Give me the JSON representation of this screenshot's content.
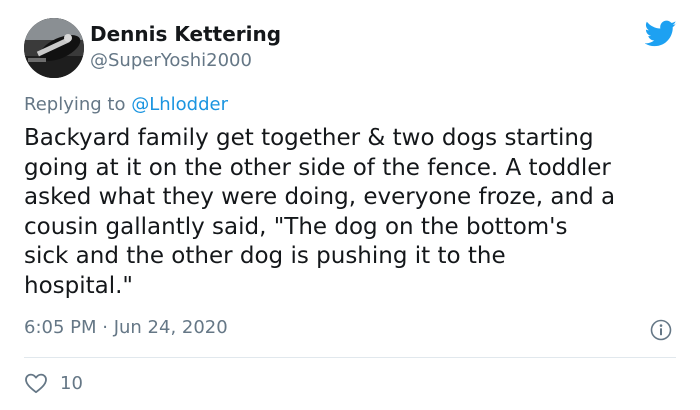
{
  "author": {
    "display_name": "Dennis Kettering",
    "handle": "@SuperYoshi2000",
    "avatar_icon": "user-avatar-photo"
  },
  "reply": {
    "prefix": "Replying to ",
    "mention": "@Lhlodder"
  },
  "tweet": {
    "text": "Backyard family get together & two dogs starting\ngoing at it on the other side of the fence. A toddler\nasked what they were doing, everyone froze, and a\ncousin gallantly said, \"The dog on the bottom's\nsick and the other dog is pushing it to the\nhospital.\"",
    "timestamp": "6:05 PM · Jun 24, 2020"
  },
  "engagement": {
    "like_count": "10"
  },
  "icons": {
    "brand": "twitter-bird-icon",
    "info": "info-icon",
    "like": "heart-icon"
  },
  "colors": {
    "brand_blue": "#1da1f2",
    "mention_blue": "#1b95e0",
    "secondary_text": "#657786",
    "primary_text": "#14171a",
    "divider": "#e1e8ed"
  }
}
